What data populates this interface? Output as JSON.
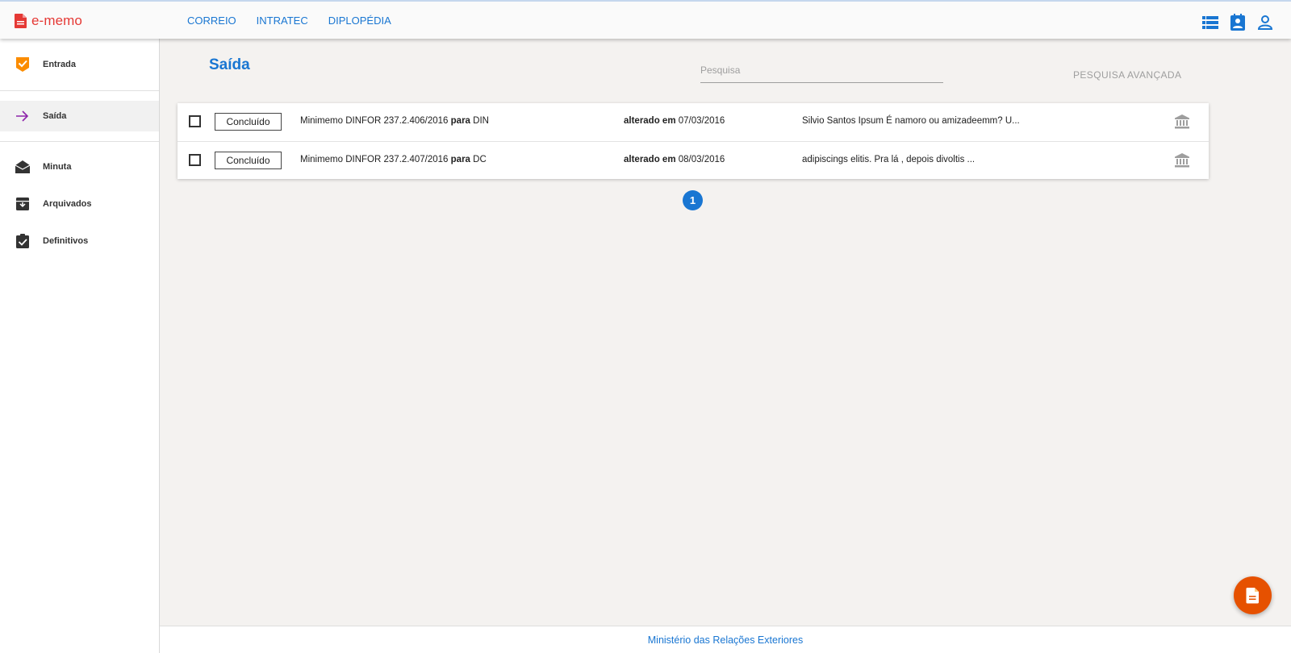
{
  "app": {
    "brand": "e-memo",
    "brand_color": "#e53935",
    "accent": "#1976d2"
  },
  "topnav": {
    "items": [
      "CORREIO",
      "INTRATEC",
      "DIPLOPÉDIA"
    ]
  },
  "top_icons": [
    "list-icon",
    "contact-card-icon",
    "user-icon"
  ],
  "sidebar": {
    "items": [
      {
        "label": "Entrada",
        "icon": "inbox-check-icon"
      },
      {
        "label": "Saída",
        "icon": "arrow-right-icon",
        "active": true
      },
      {
        "label": "Minuta",
        "icon": "drafts-icon"
      },
      {
        "label": "Arquivados",
        "icon": "archive-icon"
      },
      {
        "label": "Definitivos",
        "icon": "assignment-check-icon"
      }
    ]
  },
  "main": {
    "title": "Saída",
    "search": {
      "placeholder": "Pesquisa",
      "value": ""
    },
    "advanced_search": "PESQUISA AVANÇADA",
    "rows": [
      {
        "status": "Concluído",
        "subject": "Minimemo DINFOR 237.2.406/2016",
        "to_label": "para",
        "to": "DIN",
        "changed_label": "alterado em",
        "changed": "07/03/2016",
        "preview": "Silvio Santos Ipsum É namoro ou amizadeemm? U..."
      },
      {
        "status": "Concluído",
        "subject": "Minimemo DINFOR 237.2.407/2016",
        "to_label": "para",
        "to": "DC",
        "changed_label": "alterado em",
        "changed": "08/03/2016",
        "preview": "adipiscings elitis. Pra lá , depois divoltis ..."
      }
    ],
    "pagination": {
      "current": "1"
    }
  },
  "footer": {
    "text": "Ministério das Relações Exteriores"
  },
  "fab": {
    "icon": "new-document-icon",
    "color": "#e65100"
  }
}
